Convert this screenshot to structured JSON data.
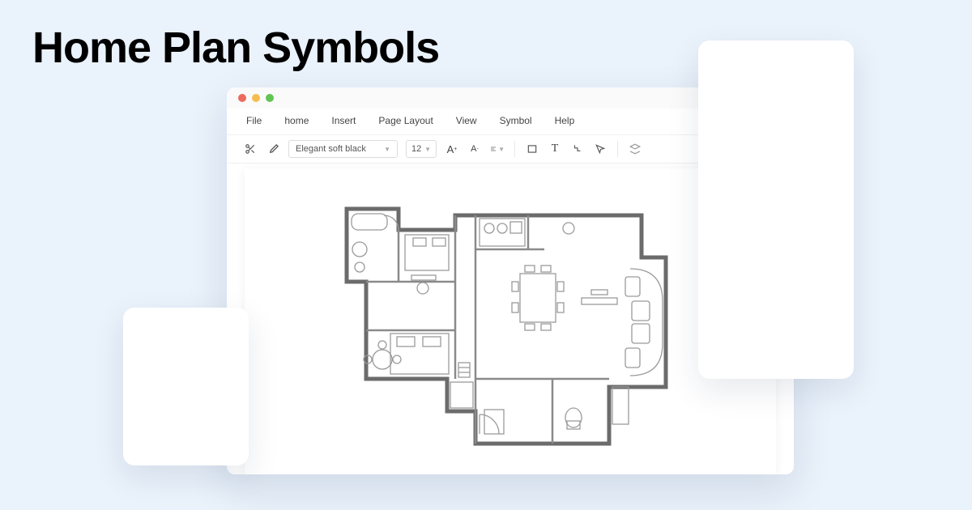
{
  "title": "Home Plan Symbols",
  "menubar": {
    "file": "File",
    "home": "home",
    "insert": "Insert",
    "pageLayout": "Page Layout",
    "view": "View",
    "symbol": "Symbol",
    "help": "Help"
  },
  "toolbar": {
    "fontName": "Elegant soft black",
    "fontSize": "12",
    "increaseFont": "A+",
    "decreaseFont": "A-"
  }
}
